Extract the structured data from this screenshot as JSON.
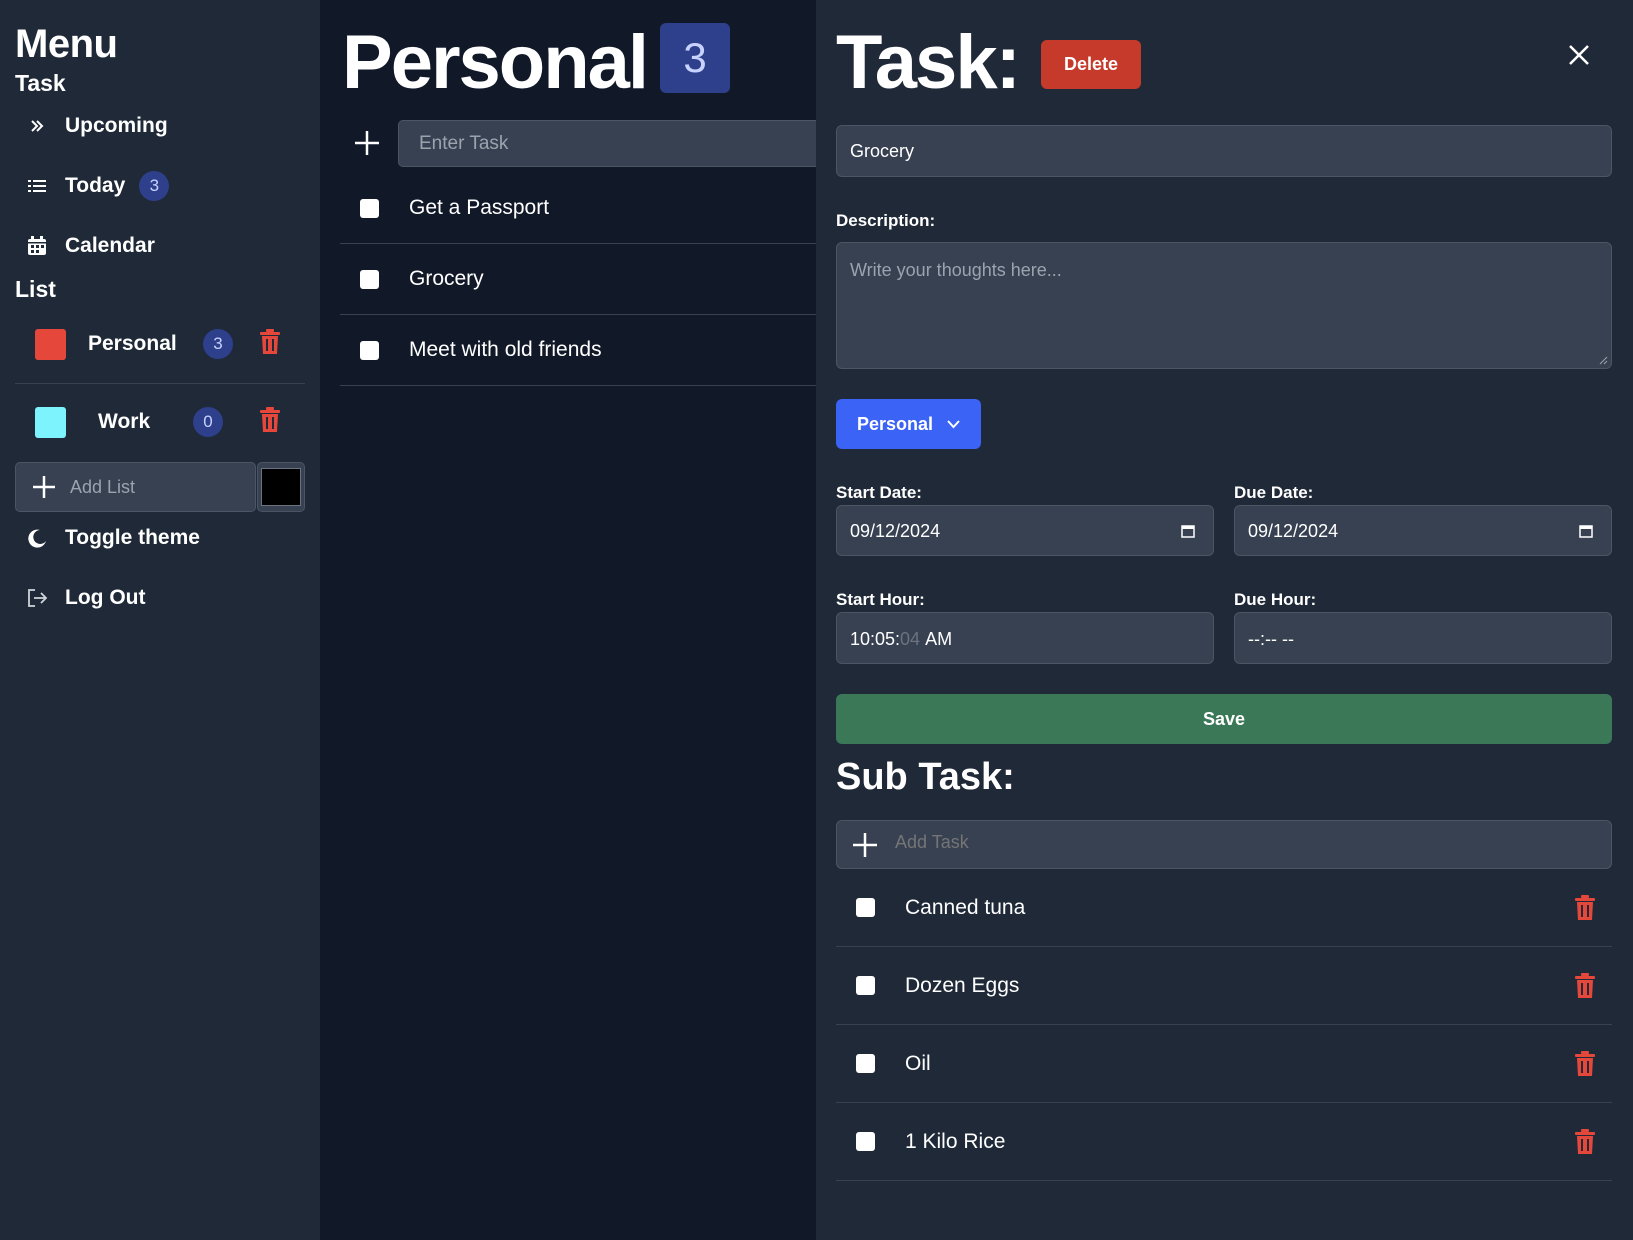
{
  "sidebar": {
    "title": "Menu",
    "task_section": "Task",
    "nav": [
      {
        "label": "Upcoming",
        "icon": "double-chevron-right-icon"
      },
      {
        "label": "Today",
        "icon": "list-icon",
        "count": "3"
      },
      {
        "label": "Calendar",
        "icon": "calendar-icon"
      }
    ],
    "list_section": "List",
    "lists": [
      {
        "name": "Personal",
        "color": "#e5483a",
        "count": "3"
      },
      {
        "name": "Work",
        "color": "#7df4fd",
        "count": "0"
      }
    ],
    "add_list_placeholder": "Add List",
    "add_list_color": "#000000",
    "toggle_theme": "Toggle theme",
    "log_out": "Log Out"
  },
  "main": {
    "title": "Personal",
    "count": "3",
    "input_placeholder": "Enter Task",
    "tasks": [
      {
        "label": "Get a Passport"
      },
      {
        "label": "Grocery"
      },
      {
        "label": "Meet with old friends"
      }
    ]
  },
  "panel": {
    "title": "Task:",
    "delete_label": "Delete",
    "task_name": "Grocery",
    "description_label": "Description:",
    "description_placeholder": "Write your thoughts here...",
    "list_select": "Personal",
    "start_date_label": "Start Date:",
    "start_date": "09/12/2024",
    "due_date_label": "Due Date:",
    "due_date": "09/12/2024",
    "start_hour_label": "Start Hour:",
    "start_hour_main": "10:05:",
    "start_hour_seconds": "04",
    "start_hour_ampm": "AM",
    "due_hour_label": "Due Hour:",
    "due_hour": "--:-- --",
    "save_label": "Save",
    "subtask_title": "Sub Task:",
    "subtask_placeholder": "Add Task",
    "subtasks": [
      {
        "label": "Canned tuna"
      },
      {
        "label": "Dozen Eggs"
      },
      {
        "label": "Oil"
      },
      {
        "label": "1 Kilo Rice"
      }
    ]
  },
  "colors": {
    "background": "#111827",
    "panel": "#1f2937",
    "accent_blue": "#3b63f6",
    "delete_red": "#c53a2a",
    "save_green": "#3b7857",
    "trash_red": "#e5483a",
    "badge": "#2e3f8c"
  }
}
